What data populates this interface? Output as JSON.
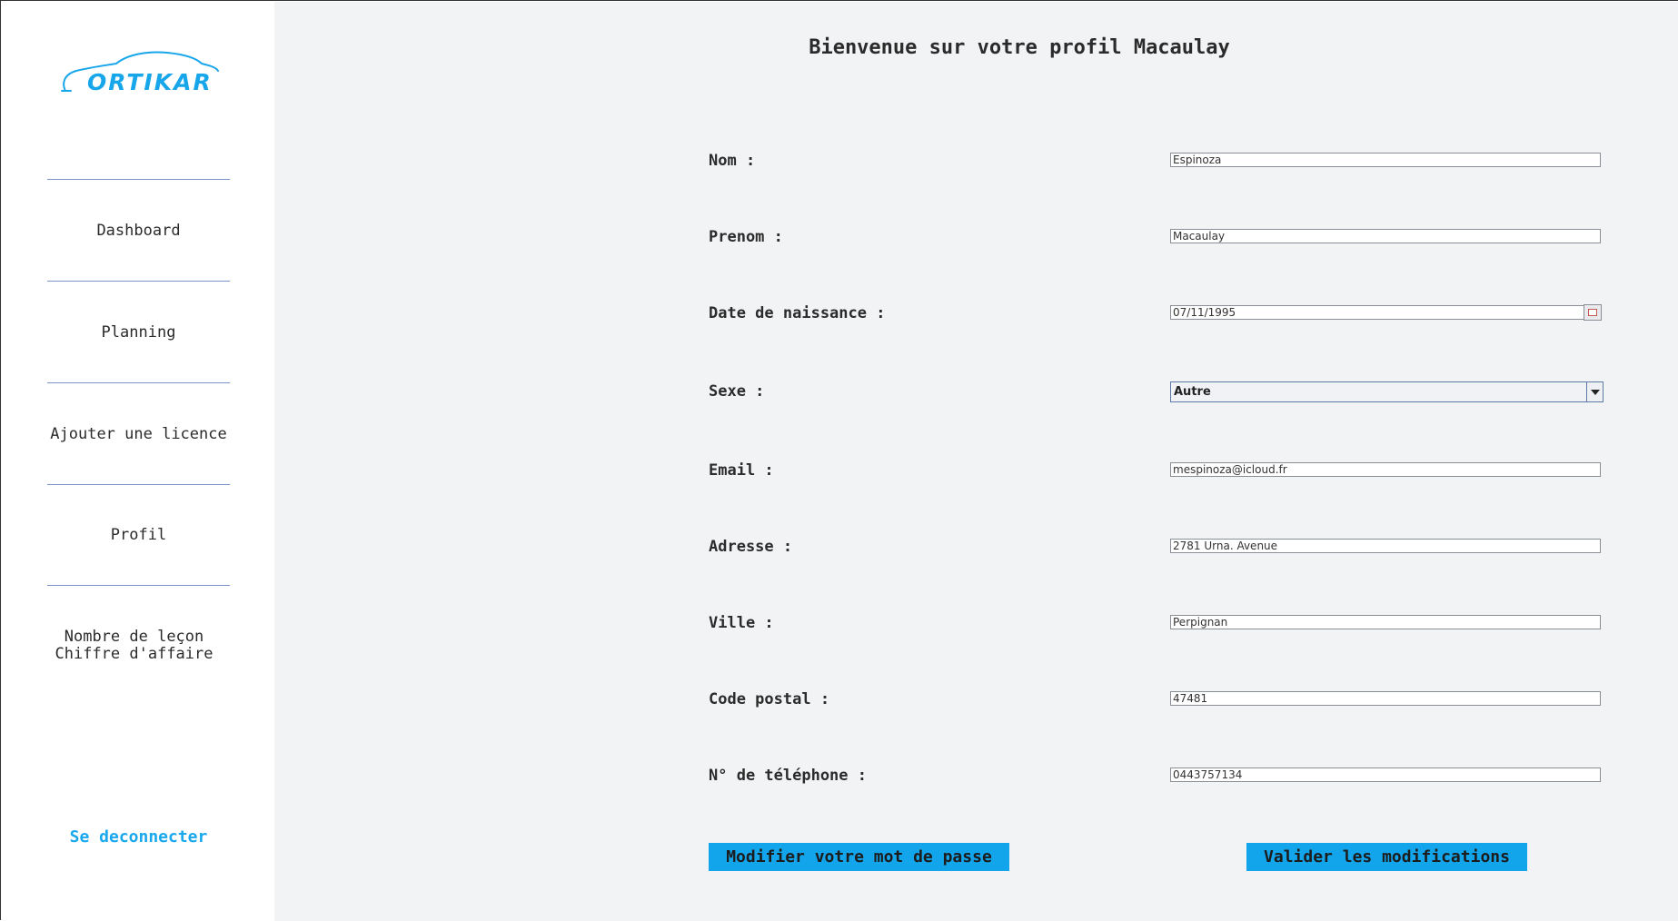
{
  "brand": {
    "logo_text": "ORTIKAR",
    "color": "#18a6ea"
  },
  "sidebar": {
    "items": [
      {
        "label": "Dashboard"
      },
      {
        "label": "Planning"
      },
      {
        "label": "Ajouter une licence"
      },
      {
        "label": "Profil"
      },
      {
        "lines": [
          "Nombre de leçon",
          "Chiffre d'affaire"
        ]
      }
    ],
    "logout_label": "Se deconnecter"
  },
  "main": {
    "title": "Bienvenue sur votre profil Macaulay",
    "fields": {
      "nom": {
        "label": "Nom :",
        "value": "Espinoza"
      },
      "prenom": {
        "label": "Prenom :",
        "value": "Macaulay"
      },
      "date_naissance": {
        "label": "Date de naissance :",
        "value": "07/11/1995",
        "button_icon": "calendar-icon"
      },
      "sexe": {
        "label": "Sexe :",
        "value": "Autre"
      },
      "email": {
        "label": "Email :",
        "value": "mespinoza@icloud.fr"
      },
      "adresse": {
        "label": "Adresse :",
        "value": "2781 Urna. Avenue"
      },
      "ville": {
        "label": "Ville :",
        "value": "Perpignan"
      },
      "code_postal": {
        "label": "Code postal :",
        "value": "47481"
      },
      "telephone": {
        "label": "N° de téléphone :",
        "value": "0443757134"
      }
    },
    "buttons": {
      "change_password": "Modifier votre mot de passe",
      "save": "Valider les modifications"
    }
  },
  "colors": {
    "accent": "#12a5ec",
    "sidebar_bg": "#ffffff",
    "main_bg": "#f2f3f5",
    "divider": "#7a93c9"
  }
}
